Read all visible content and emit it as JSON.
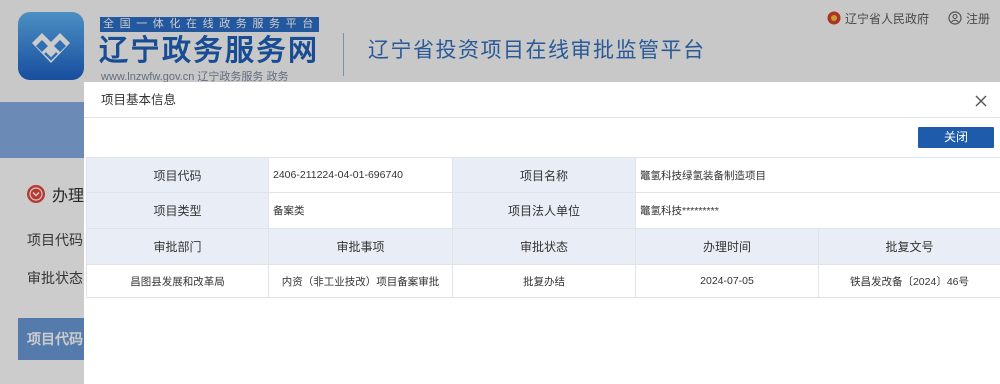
{
  "header": {
    "logo_icon": "lnzwfw-logo-icon",
    "platform_banner": "全国一体化在线政务服务平台",
    "site_name": "辽宁政务服务网",
    "site_url": "www.lnzwfw.gov.cn 辽宁政务服务 政务",
    "subsite_title": "辽宁省投资项目在线审批监管平台",
    "gov_link": {
      "icon": "emblem-icon",
      "label": "辽宁省人民政府"
    },
    "register_link": {
      "icon": "user-icon",
      "label": "注册"
    }
  },
  "sidebar": {
    "section": {
      "icon": "chevron-circle-icon",
      "title": "办理"
    },
    "field_labels": [
      "项目代码",
      "审批状态"
    ],
    "active_tab": "项目代码"
  },
  "modal": {
    "title": "项目基本信息",
    "close_icon": "close-icon",
    "close_button": "关闭",
    "basic_info": [
      {
        "label": "项目代码",
        "value": "2406-211224-04-01-696740"
      },
      {
        "label": "项目名称",
        "value": "鼈氢科技绿氢装备制造项目"
      },
      {
        "label": "项目类型",
        "value": "备案类"
      },
      {
        "label": "项目法人单位",
        "value": "鼈氢科技*********"
      }
    ],
    "approvals": {
      "columns": [
        "审批部门",
        "审批事项",
        "审批状态",
        "办理时间",
        "批复文号"
      ],
      "rows": [
        [
          "昌图县发展和改革局",
          "内资（非工业技改）项目备案审批",
          "批复办结",
          "2024-07-05",
          "铁昌发改备〔2024〕46号"
        ]
      ]
    }
  },
  "colors": {
    "primary": "#1f5bab",
    "label_cell": "#e9eef6",
    "brand": "#1f5fb8",
    "accent_red": "#e5483f"
  }
}
